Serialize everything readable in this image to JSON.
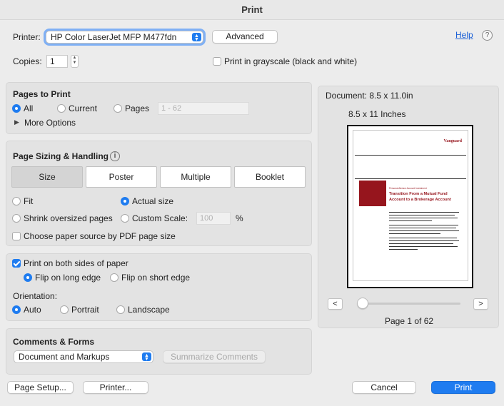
{
  "window": {
    "title": "Print"
  },
  "printer": {
    "label": "Printer:",
    "selected": "HP Color LaserJet MFP M477fdn",
    "advanced_label": "Advanced",
    "help_label": "Help",
    "help_icon": "question-circle-icon"
  },
  "copies": {
    "label": "Copies:",
    "value": "1",
    "grayscale_label": "Print in grayscale (black and white)",
    "grayscale_checked": false
  },
  "pages_to_print": {
    "title": "Pages to Print",
    "options": [
      "All",
      "Current",
      "Pages"
    ],
    "selected": "All",
    "range_placeholder": "1 - 62",
    "more_options_label": "More Options"
  },
  "sizing": {
    "title": "Page Sizing & Handling",
    "info_icon": "info-icon",
    "tabs": [
      "Size",
      "Poster",
      "Multiple",
      "Booklet"
    ],
    "active_tab": "Size",
    "fit_label": "Fit",
    "actual_size_label": "Actual size",
    "selected": "Actual size",
    "shrink_label": "Shrink oversized pages",
    "custom_scale_label": "Custom Scale:",
    "custom_scale_value": "100",
    "percent_label": "%",
    "paper_source_label": "Choose paper source by PDF page size",
    "paper_source_checked": false
  },
  "duplex": {
    "both_sides_label": "Print on both sides of paper",
    "both_sides_checked": true,
    "long_edge_label": "Flip on long edge",
    "short_edge_label": "Flip on short edge",
    "selected": "Flip on long edge"
  },
  "orientation": {
    "label": "Orientation:",
    "options": [
      "Auto",
      "Portrait",
      "Landscape"
    ],
    "selected": "Auto"
  },
  "comments": {
    "title": "Comments & Forms",
    "selected": "Document and Markups",
    "summarize_label": "Summarize Comments"
  },
  "preview": {
    "document_size": "Document: 8.5 x 11.0in",
    "paper_size": "8.5 x 11 Inches",
    "page_info": "Page 1 of 62",
    "page_fraction": 0.0,
    "prev_label": "<",
    "next_label": ">",
    "thumb": {
      "logo": "Vanguard",
      "kicker": "Personal Advisor Account Investment",
      "heading_line1": "Transition From a Mutual Fund",
      "heading_line2": "Account to a Brokerage Account",
      "brand_color": "#96151d"
    }
  },
  "footer": {
    "page_setup_label": "Page Setup...",
    "printer_label": "Printer...",
    "cancel_label": "Cancel",
    "print_label": "Print"
  },
  "colors": {
    "accent": "#1f7cf0",
    "link": "#1a5fd6"
  }
}
